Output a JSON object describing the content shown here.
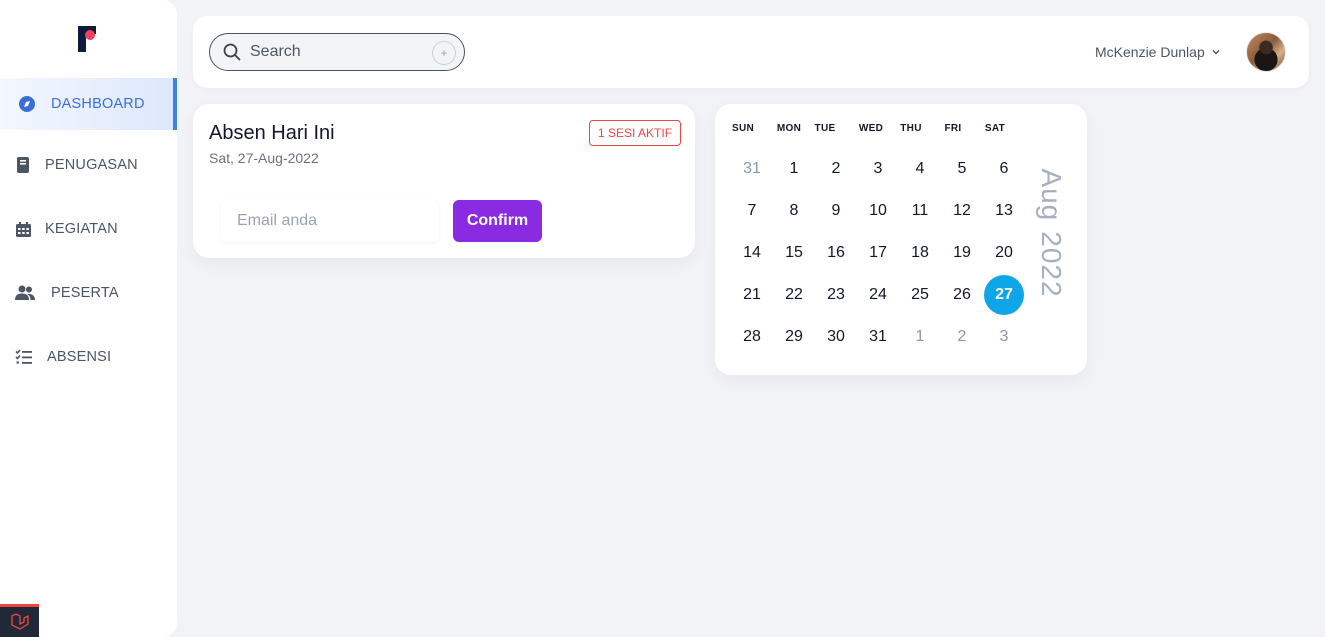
{
  "sidebar": {
    "items": [
      {
        "label": "DASHBOARD",
        "icon": "compass-icon",
        "active": true
      },
      {
        "label": "PENUGASAN",
        "icon": "book-icon",
        "active": false
      },
      {
        "label": "KEGIATAN",
        "icon": "calendar-icon",
        "active": false
      },
      {
        "label": "PESERTA",
        "icon": "users-icon",
        "active": false
      },
      {
        "label": "ABSENSI",
        "icon": "checklist-icon",
        "active": false
      }
    ],
    "accent_color": "#3b82f6"
  },
  "topbar": {
    "search_placeholder": "Search",
    "user_name": "McKenzie Dunlap"
  },
  "absen_card": {
    "title": "Absen Hari Ini",
    "date": "Sat, 27-Aug-2022",
    "badge": "1 SESI AKTIF",
    "badge_color": "#ef4444",
    "email_placeholder": "Email anda",
    "confirm_label": "Confirm",
    "confirm_color": "#8a2be2"
  },
  "calendar": {
    "weekdays": [
      "SUN",
      "MON",
      "TUE",
      "WED",
      "THU",
      "FRI",
      "SAT"
    ],
    "weeks": [
      [
        {
          "d": "31",
          "muted": true
        },
        {
          "d": "1"
        },
        {
          "d": "2"
        },
        {
          "d": "3"
        },
        {
          "d": "4"
        },
        {
          "d": "5"
        },
        {
          "d": "6"
        }
      ],
      [
        {
          "d": "7"
        },
        {
          "d": "8"
        },
        {
          "d": "9"
        },
        {
          "d": "10"
        },
        {
          "d": "11"
        },
        {
          "d": "12"
        },
        {
          "d": "13"
        }
      ],
      [
        {
          "d": "14"
        },
        {
          "d": "15"
        },
        {
          "d": "16"
        },
        {
          "d": "17"
        },
        {
          "d": "18"
        },
        {
          "d": "19"
        },
        {
          "d": "20"
        }
      ],
      [
        {
          "d": "21"
        },
        {
          "d": "22"
        },
        {
          "d": "23"
        },
        {
          "d": "24"
        },
        {
          "d": "25"
        },
        {
          "d": "26"
        },
        {
          "d": "27",
          "selected": true
        }
      ],
      [
        {
          "d": "28"
        },
        {
          "d": "29"
        },
        {
          "d": "30"
        },
        {
          "d": "31"
        },
        {
          "d": "1",
          "muted": true
        },
        {
          "d": "2",
          "muted": true
        },
        {
          "d": "3",
          "muted": true
        }
      ]
    ],
    "month": "Aug",
    "year": "2022",
    "selected_color": "#0ea5e9"
  }
}
